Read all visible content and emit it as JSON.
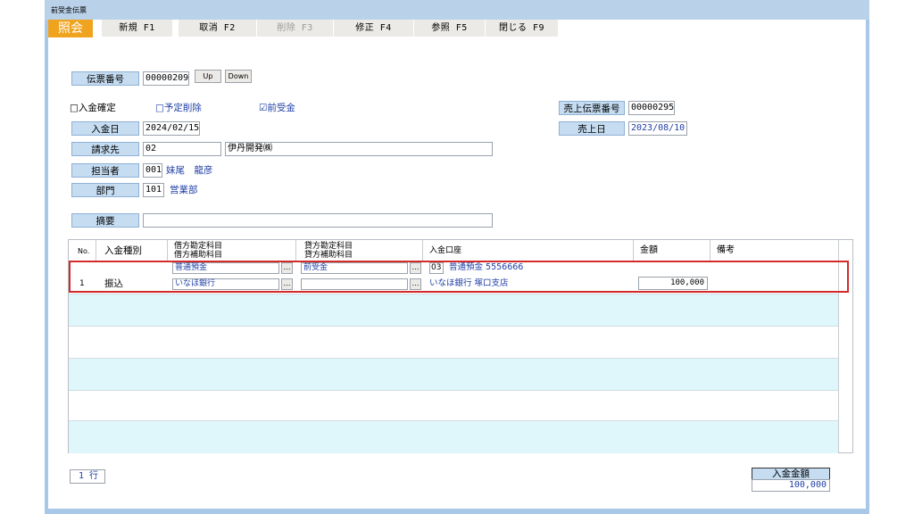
{
  "window": {
    "title": "前受金伝票"
  },
  "toolbar": {
    "mode": "照会",
    "buttons": [
      {
        "label": "新規 F1",
        "enabled": true
      },
      {
        "label": "取消 F2",
        "enabled": true
      },
      {
        "label": "削除 F3",
        "enabled": false
      },
      {
        "label": "修正 F4",
        "enabled": true
      },
      {
        "label": "参照 F5",
        "enabled": true
      },
      {
        "label": "閉じる F9",
        "enabled": true
      }
    ]
  },
  "header": {
    "voucher_no_label": "伝票番号",
    "voucher_no": "00000209",
    "up_label": "Up",
    "down_label": "Down",
    "confirm_label": "□入金確定",
    "scheduled_delete_label": "□予定削除",
    "advance_label": "☑前受金",
    "sales_voucher_label": "売上伝票番号",
    "sales_voucher_no": "00000295",
    "deposit_date_label": "入金日",
    "deposit_date": "2024/02/15",
    "sales_date_label": "売上日",
    "sales_date": "2023/08/10",
    "billing_label": "請求先",
    "billing_code": "02",
    "billing_name": "伊丹開発㈱",
    "staff_label": "担当者",
    "staff_code": "001",
    "staff_name": "妹尾　龍彦",
    "dept_label": "部門",
    "dept_code": "101",
    "dept_name": "営業部",
    "summary_label": "摘要",
    "summary": ""
  },
  "grid": {
    "columns": {
      "no": "No.",
      "type": "入金種別",
      "debit": [
        "借方勘定科目",
        "借方補助科目"
      ],
      "credit": [
        "貸方勘定科目",
        "貸方補助科目"
      ],
      "account": "入金口座",
      "amount": "金額",
      "note": "備考"
    },
    "rows": [
      {
        "no": "1",
        "type": "振込",
        "debit_main": "普通預金",
        "debit_sub": "いなほ銀行",
        "credit_main": "前受金",
        "credit_sub": "",
        "account_code": "03",
        "account_line1": "普通預金 5556666",
        "account_line2": "いなほ銀行 塚口支店",
        "amount": "100,000",
        "note": ""
      }
    ]
  },
  "footer": {
    "row_count": "1 行",
    "total_label": "入金金額",
    "total_value": "100,000"
  },
  "colors": {
    "accent": "#f0a31e",
    "label_bg": "#c5dcf1",
    "row_alt": "#dff6fa",
    "selection": "#d42a2a",
    "link_text": "#1f3fa6"
  },
  "icons": [
    "ellipsis-icon"
  ]
}
